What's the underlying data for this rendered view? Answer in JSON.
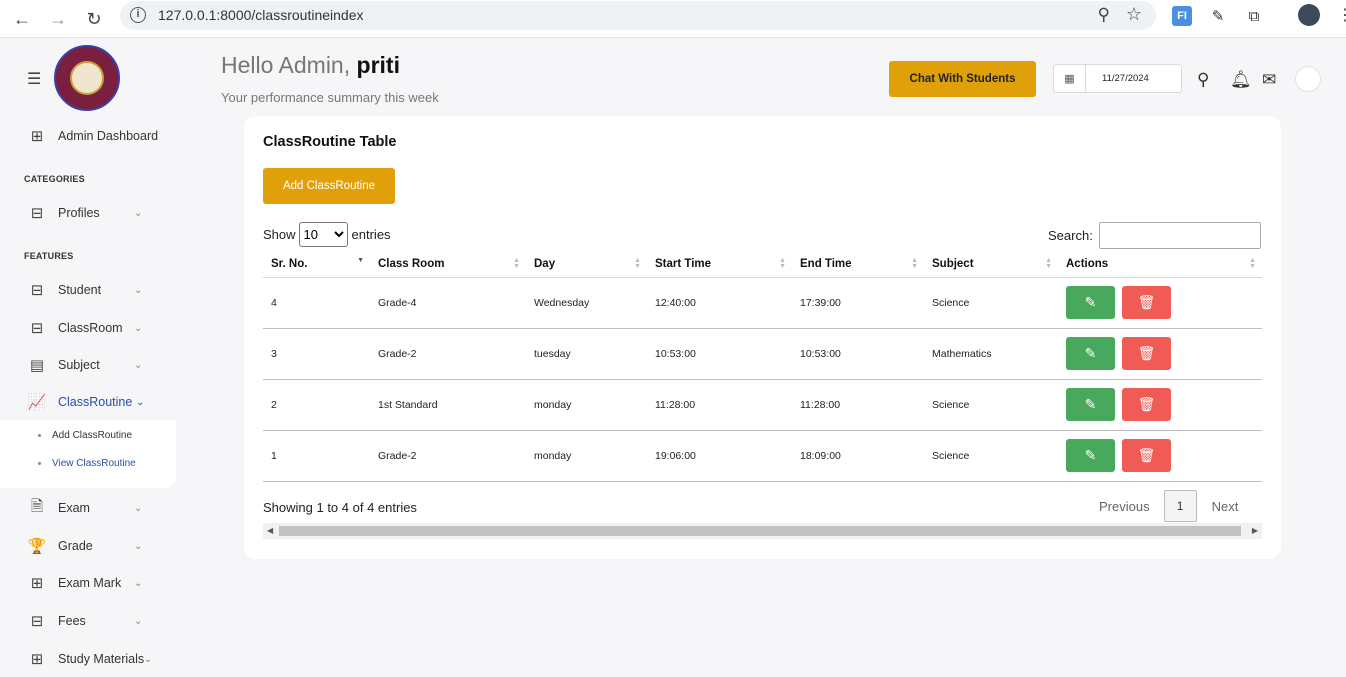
{
  "browser": {
    "url": "127.0.0.1:8000/classroutineindex",
    "ext_fi_label": "FI"
  },
  "sidebar": {
    "admin_dashboard": "Admin Dashboard",
    "categories_label": "CATEGORIES",
    "features_label": "FEATURES",
    "items": [
      {
        "label": "Profiles",
        "icon": "grid-icon"
      },
      {
        "label": "Student",
        "icon": "grid-icon"
      },
      {
        "label": "ClassRoom",
        "icon": "grid-icon"
      },
      {
        "label": "Subject",
        "icon": "list-icon"
      },
      {
        "label": "ClassRoutine",
        "icon": "chart-icon"
      },
      {
        "label": "Exam",
        "icon": "document-icon"
      },
      {
        "label": "Grade",
        "icon": "trophy-icon"
      },
      {
        "label": "Exam Mark",
        "icon": "table-icon"
      },
      {
        "label": "Fees",
        "icon": "grid-icon"
      },
      {
        "label": "Study Materials",
        "icon": "table-icon"
      }
    ],
    "sub_items": [
      "Add ClassRoutine",
      "View ClassRoutine"
    ]
  },
  "header": {
    "greeting_prefix": "Hello Admin,",
    "user_name": "priti",
    "subtitle": "Your performance summary this week",
    "chat_button": "Chat With Students",
    "date_value": "11/27/2024"
  },
  "card": {
    "title": "ClassRoutine Table",
    "add_button": "Add ClassRoutine",
    "show_label": "Show",
    "entries_label": "entries",
    "page_length": "10",
    "search_label": "Search:",
    "columns": [
      "Sr. No.",
      "Class Room",
      "Day",
      "Start Time",
      "End Time",
      "Subject",
      "Actions"
    ],
    "rows": [
      [
        "4",
        "Grade-4",
        "Wednesday",
        "12:40:00",
        "17:39:00",
        "Science"
      ],
      [
        "3",
        "Grade-2",
        "tuesday",
        "10:53:00",
        "10:53:00",
        "Mathematics"
      ],
      [
        "2",
        "1st Standard",
        "monday",
        "11:28:00",
        "11:28:00",
        "Science"
      ],
      [
        "1",
        "Grade-2",
        "monday",
        "19:06:00",
        "18:09:00",
        "Science"
      ]
    ],
    "info": "Showing 1 to 4 of 4 entries",
    "pager": {
      "previous": "Previous",
      "page": "1",
      "next": "Next"
    }
  },
  "colors": {
    "accent": "#e0a009",
    "edit": "#48a85c",
    "delete": "#f05b55",
    "active_link": "#2a4fa8"
  }
}
